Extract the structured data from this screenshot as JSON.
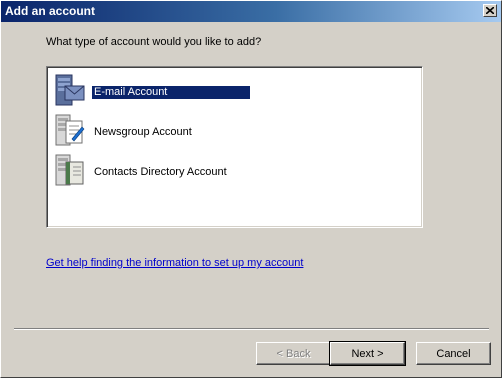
{
  "window": {
    "title": "Add an account",
    "close_icon": "close-icon"
  },
  "prompt": "What type of account would you like to add?",
  "account_types": [
    {
      "label": "E-mail Account",
      "icon": "email-account-icon",
      "selected": true
    },
    {
      "label": "Newsgroup Account",
      "icon": "newsgroup-account-icon",
      "selected": false
    },
    {
      "label": "Contacts Directory Account",
      "icon": "contacts-directory-icon",
      "selected": false
    }
  ],
  "help_link": "Get help finding the information to set up my account",
  "buttons": {
    "back": "< Back",
    "next": "Next >",
    "cancel": "Cancel"
  },
  "colors": {
    "selection": "#0a246a",
    "link": "#0000cc",
    "dialog_bg": "#d4d0c8"
  }
}
